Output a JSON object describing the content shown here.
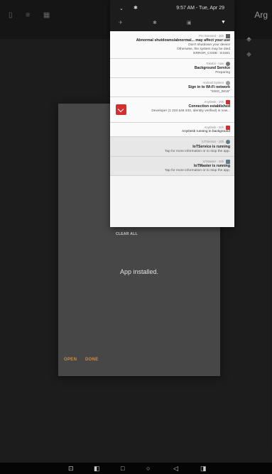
{
  "status_bar": {
    "time_date": "9:57 AM - Tue, Apr 29"
  },
  "app_bar": {
    "title": "Arg"
  },
  "dialog": {
    "message": "App installed.",
    "done_label": "DONE",
    "open_label": "OPEN"
  },
  "clear_all_label": "CLEAR ALL",
  "notifications": [
    {
      "app": "Pro Stressed - 20h",
      "title": "Abnormal shutdowns/abnormal... may affect your use",
      "lines": [
        "Don't shutdown your device",
        "Otherwise, the system may be died",
        "ERROR_CODE : E1501"
      ],
      "icon": "warning-icon",
      "icon_color": "#616161"
    },
    {
      "app": "Takeful - now",
      "title": "Background Service",
      "lines": [
        "Preparing"
      ],
      "icon": "shield-icon",
      "icon_color": "#757575"
    },
    {
      "app": "Android System",
      "title": "Sign in to Wi-Fi network",
      "lines": [
        "\"SSID_0815\""
      ],
      "icon": "wifi-icon",
      "icon_color": "#9e9e9e"
    },
    {
      "app": "AnyDesk - 20h",
      "title": "Connection established",
      "lines": [
        "Developer (1 233 546 333, Identity verified) is now..."
      ],
      "icon": "anydesk-icon",
      "icon_color": "#d32f2f"
    },
    {
      "app": "AnyDesk - 20h",
      "title": "",
      "lines": [
        "AnyDesk running in background"
      ],
      "icon": "anydesk-icon",
      "icon_color": "#d32f2f"
    },
    {
      "app": "IoTService - 20h",
      "title": "IoTService is running",
      "lines": [
        "Tap for more information or to stop the app."
      ],
      "icon": "iot-icon",
      "icon_color": "#607d8b"
    },
    {
      "app": "IoTMaster - 20h",
      "title": "IoTMaster is running",
      "lines": [
        "Tap for more information or to stop the app."
      ],
      "icon": "iot-icon",
      "icon_color": "#607d8b"
    }
  ]
}
